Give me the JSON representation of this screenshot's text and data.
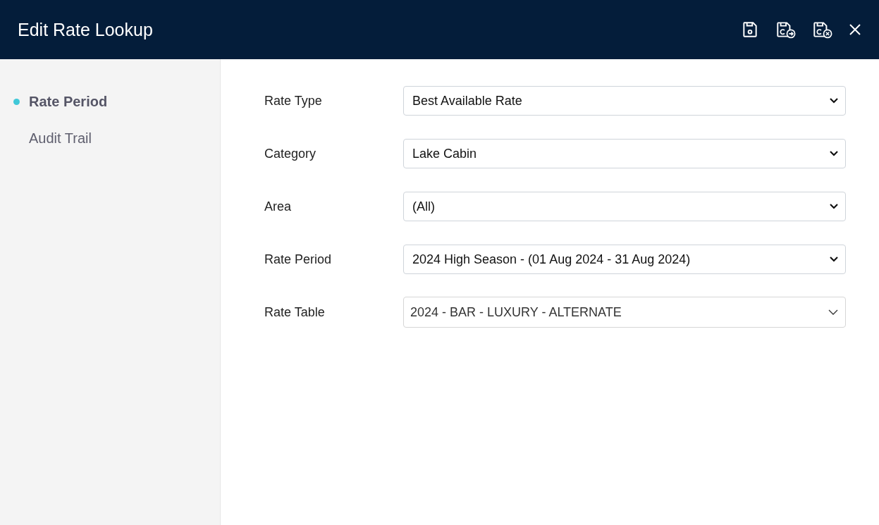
{
  "window": {
    "title": "Edit Rate Lookup"
  },
  "sidebar": {
    "items": [
      {
        "label": "Rate Period",
        "selected": true
      },
      {
        "label": "Audit Trail",
        "selected": false
      }
    ]
  },
  "form": {
    "fields": [
      {
        "label": "Rate Type",
        "value": "Best Available Rate",
        "kind": "select"
      },
      {
        "label": "Category",
        "value": "Lake Cabin",
        "kind": "select"
      },
      {
        "label": "Area",
        "value": "(All)",
        "kind": "select"
      },
      {
        "label": "Rate Period",
        "value": "2024 High Season - (01 Aug 2024 - 31 Aug 2024)",
        "kind": "select"
      },
      {
        "label": "Rate Table",
        "value": "2024 - BAR - LUXURY - ALTERNATE",
        "kind": "combo"
      }
    ]
  }
}
